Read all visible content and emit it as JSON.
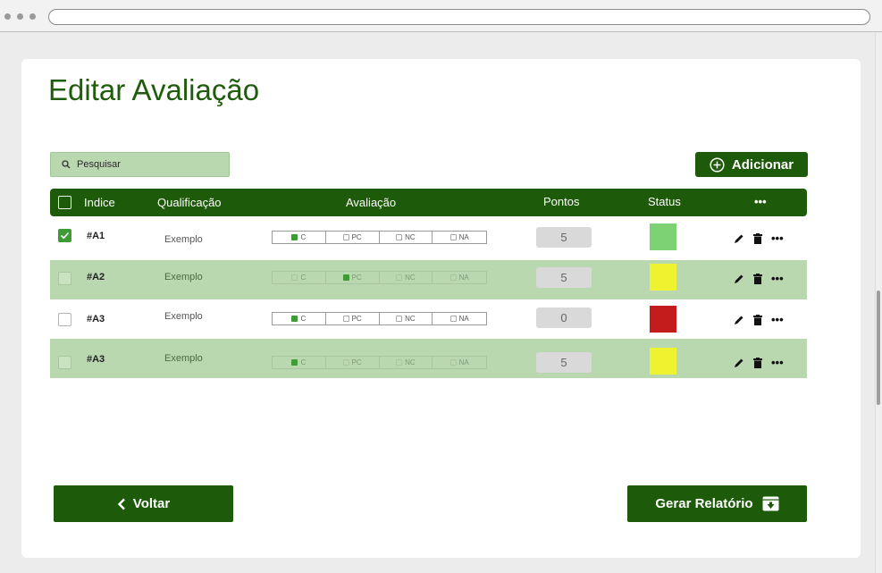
{
  "page": {
    "title": "Editar Avaliação"
  },
  "search": {
    "placeholder": "Pesquisar"
  },
  "toolbar": {
    "add_label": "Adicionar"
  },
  "table": {
    "headers": {
      "indice": "Indice",
      "qualificacao": "Qualificação",
      "avaliacao": "Avaliação",
      "pontos": "Pontos",
      "status": "Status",
      "more": "•••"
    },
    "options": [
      "C",
      "PC",
      "NC",
      "NA"
    ],
    "rows": [
      {
        "selected": true,
        "index": "#A1",
        "qualification": "Exemplo",
        "evaluation": "C",
        "points": "5",
        "status_color": "#7dd373"
      },
      {
        "selected": false,
        "index": "#A2",
        "qualification": "Exemplo",
        "evaluation": "PC",
        "points": "5",
        "status_color": "#eef22f"
      },
      {
        "selected": false,
        "index": "#A3",
        "qualification": "Exemplo",
        "evaluation": "C",
        "points": "0",
        "status_color": "#c41c1c"
      },
      {
        "selected": false,
        "index": "#A3",
        "qualification": "Exemplo",
        "evaluation": "C",
        "points": "5",
        "status_color": "#eef22f"
      }
    ],
    "row_more": "•••"
  },
  "footer": {
    "back_label": "Voltar",
    "report_label": "Gerar Relatório"
  },
  "colors": {
    "brand": "#1d5a09",
    "highlight_row": "#b9d8b0"
  }
}
